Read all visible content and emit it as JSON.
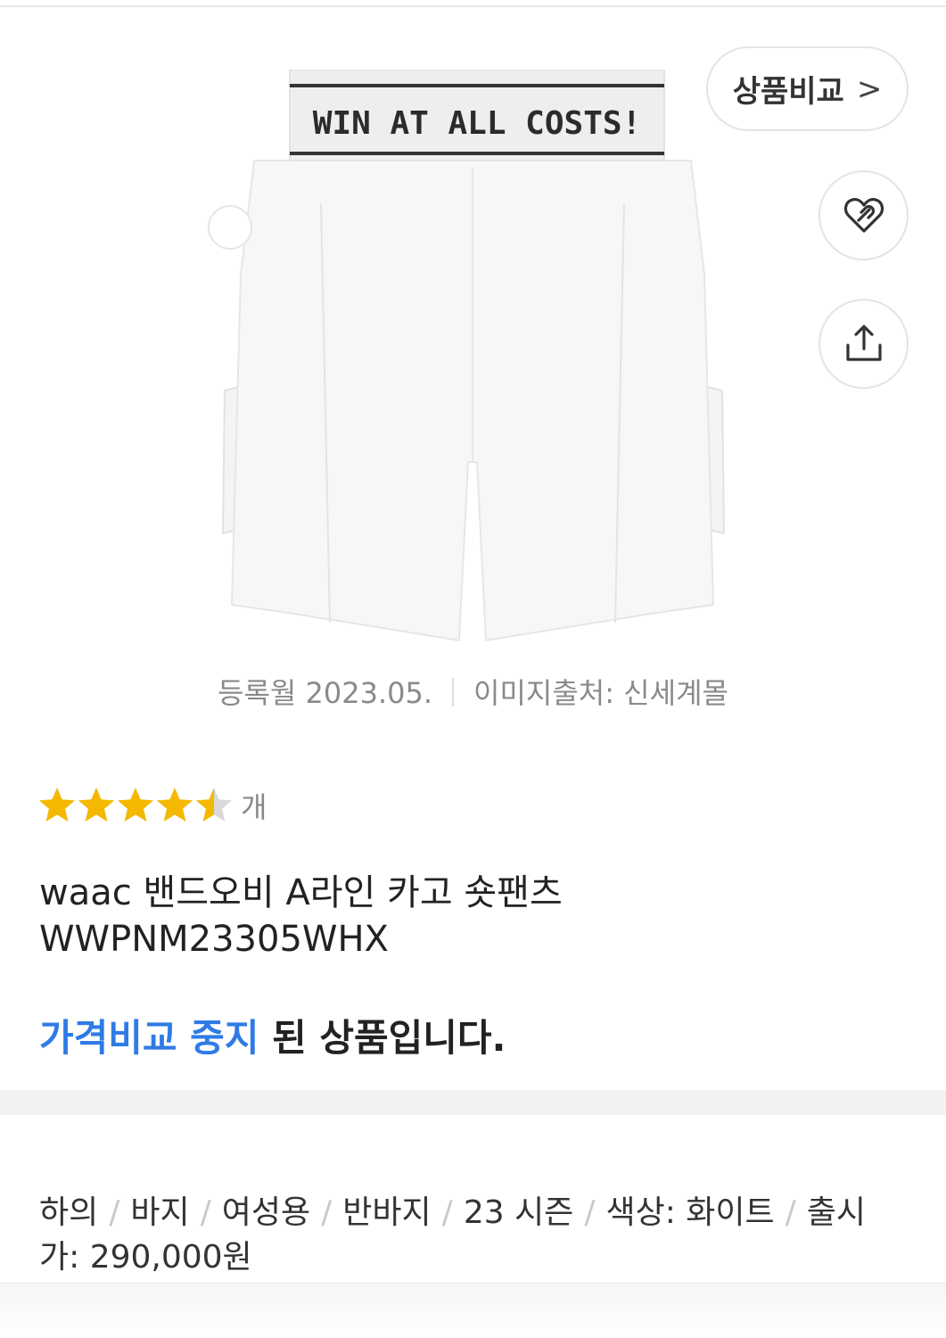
{
  "product_image": {
    "waistband_text": "WIN AT ALL COSTS!"
  },
  "actions": {
    "compare_label": "상품비교",
    "compare_chevron": ">",
    "wish_icon": "heart-link-icon",
    "share_icon": "share-icon"
  },
  "meta": {
    "registered": "등록월 2023.05.",
    "image_source": "이미지출처: 신세계몰"
  },
  "rating": {
    "stars": 4.5,
    "max": 5,
    "count_suffix": "개",
    "color": "#f5b800"
  },
  "product": {
    "title_line1": "waac 밴드오비 A라인 카고 숏팬츠",
    "title_line2": "WWPNM23305WHX"
  },
  "notice": {
    "highlight": "가격비교 중지",
    "rest": " 된 상품입니다.",
    "highlight_color": "#2f7be6"
  },
  "specs": {
    "items": [
      "하의",
      "바지",
      "여성용",
      "반바지",
      "23 시즌",
      "색상: 화이트",
      "출시가: 290,000원"
    ]
  }
}
